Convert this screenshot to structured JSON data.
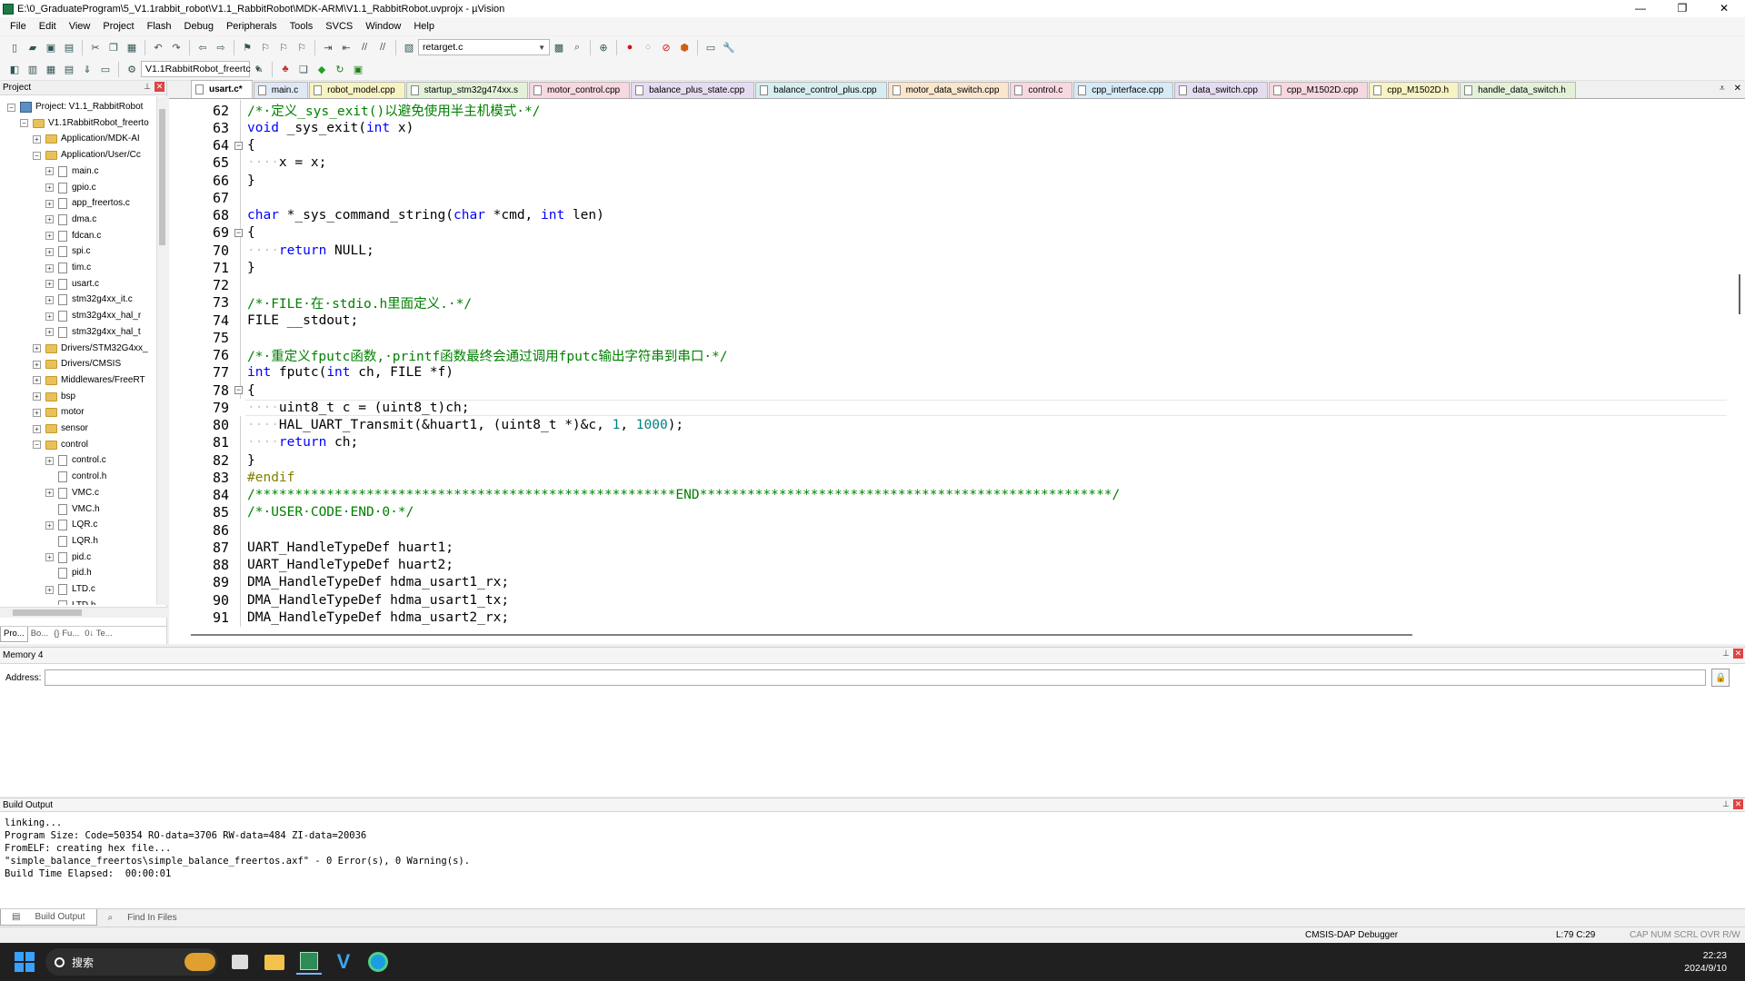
{
  "window": {
    "title": "E:\\0_GraduateProgram\\5_V1.1rabbit_robot\\V1.1_RabbitRobot\\MDK-ARM\\V1.1_RabbitRobot.uvprojx - µVision",
    "minimize": "—",
    "restore": "❐",
    "close": "✕"
  },
  "menu": [
    "File",
    "Edit",
    "View",
    "Project",
    "Flash",
    "Debug",
    "Peripherals",
    "Tools",
    "SVCS",
    "Window",
    "Help"
  ],
  "toolbar": {
    "find_file": "retarget.c",
    "target": "V1.1RabbitRobot_freertc"
  },
  "project_panel": {
    "title": "Project",
    "tree": [
      {
        "label": "Project: V1.1_RabbitRobot",
        "depth": 0,
        "kind": "project",
        "exp": "-"
      },
      {
        "label": "V1.1RabbitRobot_freerto",
        "depth": 1,
        "kind": "folder",
        "exp": "-"
      },
      {
        "label": "Application/MDK-AI",
        "depth": 2,
        "kind": "folder",
        "exp": "+"
      },
      {
        "label": "Application/User/Cc",
        "depth": 2,
        "kind": "folder",
        "exp": "-"
      },
      {
        "label": "main.c",
        "depth": 3,
        "kind": "file",
        "exp": "+"
      },
      {
        "label": "gpio.c",
        "depth": 3,
        "kind": "file",
        "exp": "+"
      },
      {
        "label": "app_freertos.c",
        "depth": 3,
        "kind": "file",
        "exp": "+"
      },
      {
        "label": "dma.c",
        "depth": 3,
        "kind": "file",
        "exp": "+"
      },
      {
        "label": "fdcan.c",
        "depth": 3,
        "kind": "file",
        "exp": "+"
      },
      {
        "label": "spi.c",
        "depth": 3,
        "kind": "file",
        "exp": "+"
      },
      {
        "label": "tim.c",
        "depth": 3,
        "kind": "file",
        "exp": "+"
      },
      {
        "label": "usart.c",
        "depth": 3,
        "kind": "file",
        "exp": "+"
      },
      {
        "label": "stm32g4xx_it.c",
        "depth": 3,
        "kind": "file",
        "exp": "+"
      },
      {
        "label": "stm32g4xx_hal_r",
        "depth": 3,
        "kind": "file",
        "exp": "+"
      },
      {
        "label": "stm32g4xx_hal_t",
        "depth": 3,
        "kind": "file",
        "exp": "+"
      },
      {
        "label": "Drivers/STM32G4xx_",
        "depth": 2,
        "kind": "folder",
        "exp": "+"
      },
      {
        "label": "Drivers/CMSIS",
        "depth": 2,
        "kind": "folder",
        "exp": "+"
      },
      {
        "label": "Middlewares/FreeRT",
        "depth": 2,
        "kind": "folder",
        "exp": "+"
      },
      {
        "label": "bsp",
        "depth": 2,
        "kind": "folder",
        "exp": "+"
      },
      {
        "label": "motor",
        "depth": 2,
        "kind": "folder",
        "exp": "+"
      },
      {
        "label": "sensor",
        "depth": 2,
        "kind": "folder",
        "exp": "+"
      },
      {
        "label": "control",
        "depth": 2,
        "kind": "folder",
        "exp": "-"
      },
      {
        "label": "control.c",
        "depth": 3,
        "kind": "file",
        "exp": "+"
      },
      {
        "label": "control.h",
        "depth": 3,
        "kind": "file",
        "exp": ""
      },
      {
        "label": "VMC.c",
        "depth": 3,
        "kind": "file",
        "exp": "+"
      },
      {
        "label": "VMC.h",
        "depth": 3,
        "kind": "file",
        "exp": ""
      },
      {
        "label": "LQR.c",
        "depth": 3,
        "kind": "file",
        "exp": "+"
      },
      {
        "label": "LQR.h",
        "depth": 3,
        "kind": "file",
        "exp": ""
      },
      {
        "label": "pid.c",
        "depth": 3,
        "kind": "file",
        "exp": "+"
      },
      {
        "label": "pid.h",
        "depth": 3,
        "kind": "file",
        "exp": ""
      },
      {
        "label": "LTD.c",
        "depth": 3,
        "kind": "file",
        "exp": "+"
      },
      {
        "label": "LTD.h",
        "depth": 3,
        "kind": "file",
        "exp": ""
      }
    ],
    "tabs": [
      "Pro...",
      "Bo...",
      "{} Fu...",
      "0↓ Te..."
    ]
  },
  "editor": {
    "tabs": [
      {
        "label": "usart.c*",
        "active": true,
        "color": "#ffffff"
      },
      {
        "label": "main.c",
        "active": false,
        "color": "#dfe9f5"
      },
      {
        "label": "robot_model.cpp",
        "active": false,
        "color": "#f7f3c2"
      },
      {
        "label": "startup_stm32g474xx.s",
        "active": false,
        "color": "#e3f1d9"
      },
      {
        "label": "motor_control.cpp",
        "active": false,
        "color": "#f7d7e0"
      },
      {
        "label": "balance_plus_state.cpp",
        "active": false,
        "color": "#e6dcf2"
      },
      {
        "label": "balance_control_plus.cpp",
        "active": false,
        "color": "#d6eef0"
      },
      {
        "label": "motor_data_switch.cpp",
        "active": false,
        "color": "#f9e6cc"
      },
      {
        "label": "control.c",
        "active": false,
        "color": "#f7d7e0"
      },
      {
        "label": "cpp_interface.cpp",
        "active": false,
        "color": "#d6eaf7"
      },
      {
        "label": "data_switch.cpp",
        "active": false,
        "color": "#e6dcf2"
      },
      {
        "label": "cpp_M1502D.cpp",
        "active": false,
        "color": "#f7d7e0"
      },
      {
        "label": "cpp_M1502D.h",
        "active": false,
        "color": "#f7f3c2"
      },
      {
        "label": "handle_data_switch.h",
        "active": false,
        "color": "#e3f1d9"
      }
    ],
    "lines": [
      {
        "n": "62",
        "fold": "",
        "html": "<span class=\"cm\">/*·定义_sys_exit()以避免使用半主机模式·*/</span>"
      },
      {
        "n": "63",
        "fold": "",
        "html": "<span class=\"kw\">void</span> _sys_exit(<span class=\"kw\">int</span> x)"
      },
      {
        "n": "64",
        "fold": "-",
        "html": "{"
      },
      {
        "n": "65",
        "fold": "",
        "html": "    x = x;"
      },
      {
        "n": "66",
        "fold": "",
        "html": "}"
      },
      {
        "n": "67",
        "fold": "",
        "html": ""
      },
      {
        "n": "68",
        "fold": "",
        "html": "<span class=\"kw\">char</span> *_sys_command_string(<span class=\"kw\">char</span> *cmd, <span class=\"kw\">int</span> len)"
      },
      {
        "n": "69",
        "fold": "-",
        "html": "{"
      },
      {
        "n": "70",
        "fold": "",
        "html": "    <span class=\"kw\">return</span> NULL;"
      },
      {
        "n": "71",
        "fold": "",
        "html": "}"
      },
      {
        "n": "72",
        "fold": "",
        "html": ""
      },
      {
        "n": "73",
        "fold": "",
        "html": "<span class=\"cm\">/*·FILE·在·stdio.h里面定义.·*/</span>"
      },
      {
        "n": "74",
        "fold": "",
        "html": "FILE __stdout;"
      },
      {
        "n": "75",
        "fold": "",
        "html": ""
      },
      {
        "n": "76",
        "fold": "",
        "html": "<span class=\"cm\">/*·重定义fputc函数,·printf函数最终会通过调用fputc输出字符串到串口·*/</span>"
      },
      {
        "n": "77",
        "fold": "",
        "html": "<span class=\"kw\">int</span> fputc(<span class=\"kw\">int</span> ch, FILE *f)"
      },
      {
        "n": "78",
        "fold": "-",
        "html": "{"
      },
      {
        "n": "79",
        "fold": "",
        "html": "    uint8_t c = (uint8_t)ch;",
        "current": true
      },
      {
        "n": "80",
        "fold": "",
        "html": "    HAL_UART_Transmit(&amp;huart1, (uint8_t *)&amp;c, <span class=\"num\">1</span>, <span class=\"num\">1000</span>);"
      },
      {
        "n": "81",
        "fold": "",
        "html": "    <span class=\"kw\">return</span> ch;"
      },
      {
        "n": "82",
        "fold": "",
        "html": "}"
      },
      {
        "n": "83",
        "fold": "",
        "html": "<span class=\"pp\">#endif</span>"
      },
      {
        "n": "84",
        "fold": "",
        "html": "<span class=\"cm\">/*****************************************************END****************************************************/</span>"
      },
      {
        "n": "85",
        "fold": "",
        "html": "<span class=\"cm\">/*·USER·CODE·END·0·*/</span>"
      },
      {
        "n": "86",
        "fold": "",
        "html": ""
      },
      {
        "n": "87",
        "fold": "",
        "html": "UART_HandleTypeDef huart1;"
      },
      {
        "n": "88",
        "fold": "",
        "html": "UART_HandleTypeDef huart2;"
      },
      {
        "n": "89",
        "fold": "",
        "html": "DMA_HandleTypeDef hdma_usart1_rx;"
      },
      {
        "n": "90",
        "fold": "",
        "html": "DMA_HandleTypeDef hdma_usart1_tx;"
      },
      {
        "n": "91",
        "fold": "",
        "html": "DMA_HandleTypeDef hdma_usart2_rx;"
      }
    ]
  },
  "memory_panel": {
    "title": "Memory 4",
    "address_label": "Address:",
    "address_value": ""
  },
  "build_panel": {
    "title": "Build Output",
    "text": "linking...\nProgram Size: Code=50354 RO-data=3706 RW-data=484 ZI-data=20036\nFromELF: creating hex file...\n\"simple_balance_freertos\\simple_balance_freertos.axf\" - 0 Error(s), 0 Warning(s).\nBuild Time Elapsed:  00:00:01",
    "tabs": [
      "Build Output",
      "Find In Files"
    ]
  },
  "statusbar": {
    "debugger": "CMSIS-DAP Debugger",
    "position": "L:79 C:29",
    "flags": "CAP  NUM  SCRL  OVR  R/W"
  },
  "taskbar": {
    "search": "搜索",
    "time": "22:23",
    "date": "2024/9/10"
  },
  "colors": {
    "keyword": "#0000ff",
    "comment": "#008000",
    "number": "#008080",
    "preprocessor": "#808000"
  }
}
